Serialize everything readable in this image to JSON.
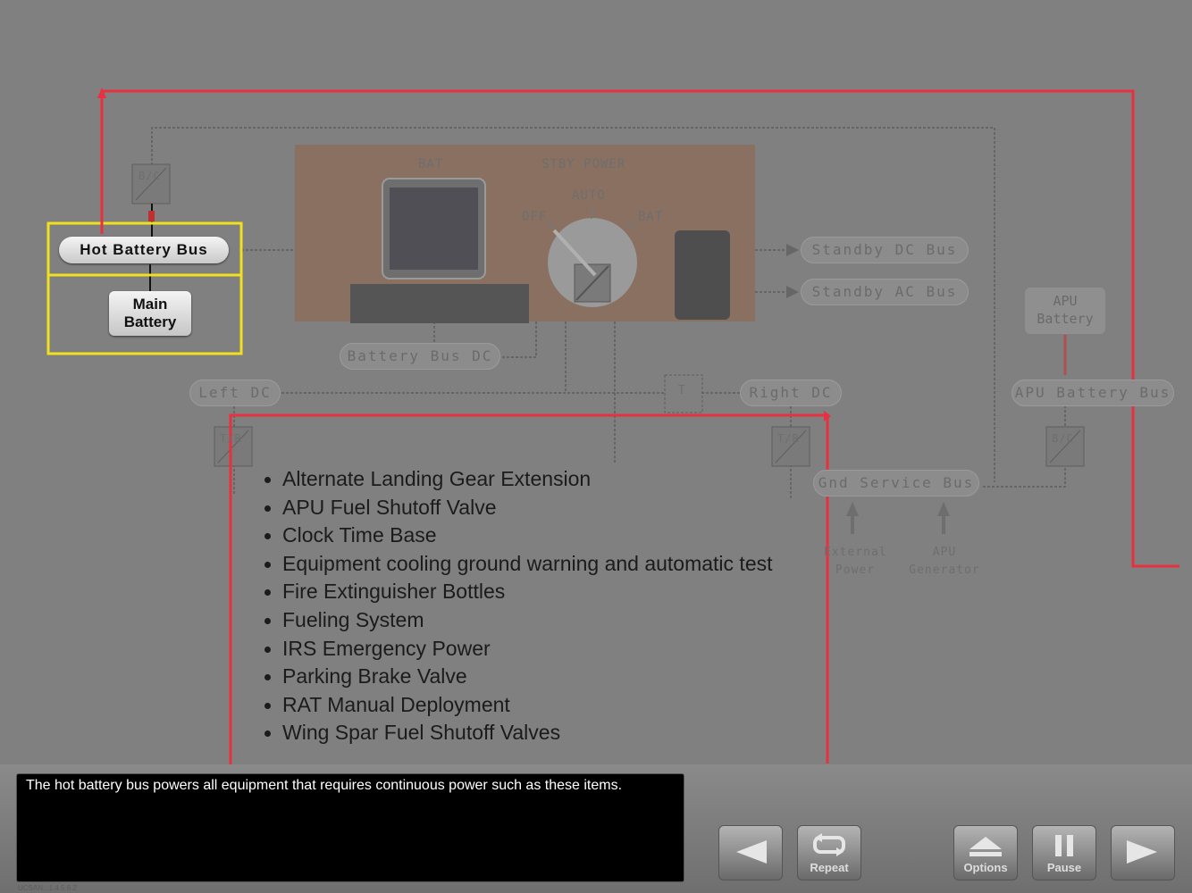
{
  "diagram": {
    "panel": {
      "bat_label": "BAT",
      "stby_power_label": "STBY POWER",
      "switch_positions": {
        "auto": "AUTO",
        "off": "OFF",
        "bat": "BAT"
      }
    },
    "highlighted": {
      "hot_battery_bus": "Hot Battery Bus",
      "main_battery_line1": "Main",
      "main_battery_line2": "Battery"
    },
    "buses": {
      "standby_dc": "Standby DC Bus",
      "standby_ac": "Standby AC Bus",
      "battery_bus_dc": "Battery Bus DC",
      "left_dc": "Left DC",
      "right_dc": "Right DC",
      "apu_battery_line1": "APU",
      "apu_battery_line2": "Battery",
      "apu_battery_bus": "APU Battery Bus",
      "gnd_service_bus": "Gnd Service Bus"
    },
    "converters": {
      "bc": "B/C",
      "tr_left": "T/R",
      "tr_right": "T/R",
      "bc_apu": "B/C",
      "tie": "T"
    },
    "sources": {
      "external_power_line1": "External",
      "external_power_line2": "Power",
      "apu_generator_line1": "APU",
      "apu_generator_line2": "Generator"
    }
  },
  "items": [
    "Alternate Landing Gear Extension",
    "APU Fuel Shutoff Valve",
    "Clock Time Base",
    "Equipment cooling ground warning and automatic test",
    "Fire Extinguisher Bottles",
    "Fueling System",
    "IRS Emergency Power",
    "Parking Brake Valve",
    "RAT Manual Deployment",
    "Wing Spar Fuel Shutoff Valves"
  ],
  "caption": "The hot battery bus powers all equipment that requires continuous power such as these items.",
  "controls": {
    "back": "",
    "repeat": "Repeat",
    "options": "Options",
    "pause": "Pause",
    "next": ""
  },
  "footnote": "UCSAN...1.4.5.6.2",
  "colors": {
    "background": "#808080",
    "highlight": "#f0e020",
    "trace": "#e83040",
    "panel": "#8a7060"
  }
}
